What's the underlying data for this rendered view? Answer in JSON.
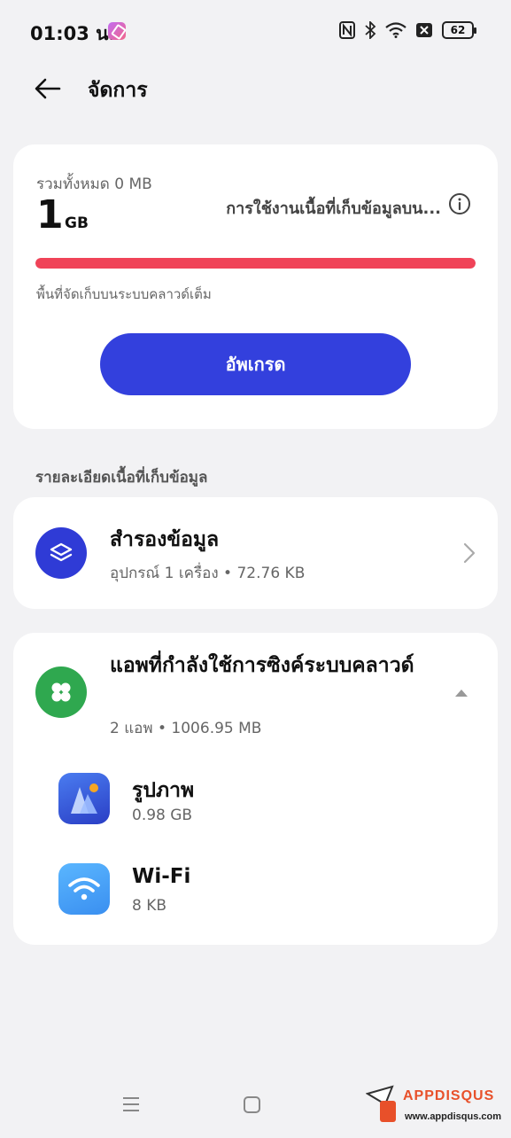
{
  "status_bar": {
    "time": "01:03 น.",
    "battery": "62",
    "icons": [
      "nfc-icon",
      "bluetooth-icon",
      "wifi-icon",
      "no-sim-icon",
      "battery-icon"
    ]
  },
  "header": {
    "title": "จัดการ",
    "back_icon": "arrow-left-icon"
  },
  "storage": {
    "total_label": "รวมทั้งหมด 0 MB",
    "quota_number": "1",
    "quota_unit": "GB",
    "usage_link": "การใช้งานเนื้อที่เก็บข้อมูลบน...",
    "progress_fraction": 1.0,
    "progress_color": "#f04358",
    "full_note": "พื้นที่จัดเก็บบนระบบคลาวด์เต็ม",
    "upgrade_label": "อัพเกรด",
    "upgrade_color": "#3340dd"
  },
  "details": {
    "section_title": "รายละเอียดเนื้อที่เก็บข้อมูล",
    "backup": {
      "title": "สำรองข้อมูล",
      "subtitle": "อุปกรณ์ 1 เครื่อง • 72.76 KB",
      "icon": "layers-icon"
    },
    "apps": {
      "title": "แอพที่กำลังใช้การซิงค์ระบบคลาวด์",
      "subtitle": "2 แอพ • 1006.95 MB",
      "icon": "clover-icon",
      "items": [
        {
          "name": "รูปภาพ",
          "size": "0.98 GB",
          "icon": "photos-icon"
        },
        {
          "name": "Wi-Fi",
          "size": "8 KB",
          "icon": "wifi-icon"
        }
      ]
    }
  },
  "watermark": {
    "brand": "APPDISQUS",
    "url": "www.appdisqus.com"
  }
}
